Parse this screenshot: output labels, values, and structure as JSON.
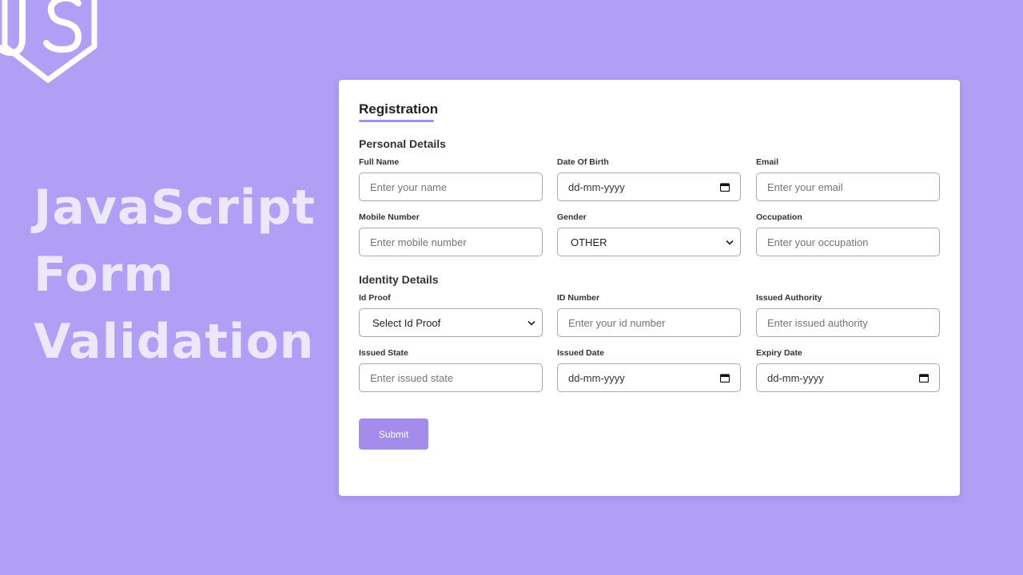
{
  "headline": [
    "JavaScript",
    "Form",
    "Validation"
  ],
  "form": {
    "title": "Registration",
    "personal_section": "Personal Details",
    "identity_section": "Identity Details",
    "submit_label": "Submit"
  },
  "fields": {
    "full_name": {
      "label": "Full Name",
      "placeholder": "Enter your name"
    },
    "dob": {
      "label": "Date Of Birth",
      "value": "dd-mm-yyyy"
    },
    "email": {
      "label": "Email",
      "placeholder": "Enter your email"
    },
    "mobile": {
      "label": "Mobile Number",
      "placeholder": "Enter mobile number"
    },
    "gender": {
      "label": "Gender",
      "value": "OTHER"
    },
    "occupation": {
      "label": "Occupation",
      "placeholder": "Enter your occupation"
    },
    "id_proof": {
      "label": "Id Proof",
      "value": "Select Id Proof"
    },
    "id_number": {
      "label": "ID Number",
      "placeholder": "Enter your id number"
    },
    "issued_authority": {
      "label": "Issued Authority",
      "placeholder": "Enter issued authority"
    },
    "issued_state": {
      "label": "Issued State",
      "placeholder": "Enter issued state"
    },
    "issued_date": {
      "label": "Issued Date",
      "value": "dd-mm-yyyy"
    },
    "expiry_date": {
      "label": "Expiry Date",
      "value": "dd-mm-yyyy"
    }
  },
  "colors": {
    "background": "#b19ef5",
    "accent": "#a38cec",
    "headline": "#ece8fb"
  }
}
